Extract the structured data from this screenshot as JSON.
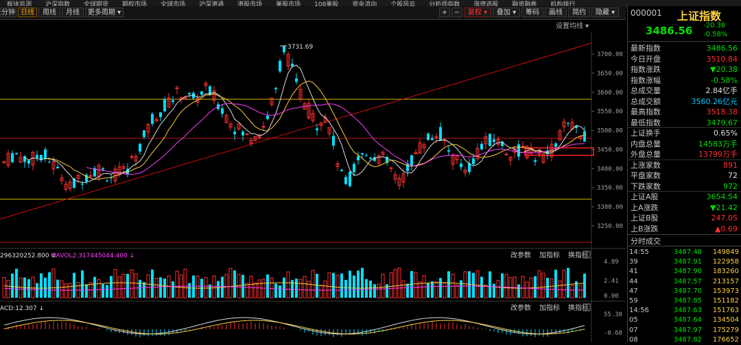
{
  "top_nav": [
    "板块监测",
    "沪深指数",
    "全球期货",
    "期权市场",
    "全球市场",
    "沪深港通",
    "港股市场",
    "美股市场",
    "108美股",
    "资金流向",
    "个股风云",
    "分析师指数",
    "涨停选股",
    "融资融券",
    "机构排行"
  ],
  "toolbar": {
    "periods": [
      {
        "label": "分钟",
        "active": false
      },
      {
        "label": "日线",
        "active": true
      },
      {
        "label": "周线",
        "active": false
      },
      {
        "label": "月线",
        "active": false
      },
      {
        "label": "更多周期 ▾",
        "active": false
      }
    ],
    "right_buttons": [
      {
        "label": "+",
        "kind": "plain"
      },
      {
        "label": "−",
        "kind": "plain"
      },
      {
        "label": "复权 ▾",
        "kind": "red"
      },
      {
        "label": "叠加 ▾",
        "kind": "plain"
      },
      {
        "label": "筹码",
        "kind": "plain"
      },
      {
        "label": "画线",
        "kind": "plain"
      },
      {
        "label": "简约",
        "kind": "plain"
      },
      {
        "label": "隐藏 ▾",
        "kind": "plain"
      }
    ],
    "settings_ma": "设置均线 ▾"
  },
  "main_chart": {
    "high_marker": "3731.69",
    "y_ticks": [
      "3700.00",
      "3650.00",
      "3600.00",
      "3550.00",
      "3500.00",
      "3450.00",
      "3400.00",
      "3350.00",
      "3300.00",
      "3250.00"
    ]
  },
  "volume_panel": {
    "label1": "296320252.800 ↓",
    "label2": "MAVOL2:317445044.400 ↓",
    "buttons": [
      "改参数",
      "加指标",
      "换指标"
    ],
    "y_ticks": [
      "4.89",
      "2.41",
      "0.00"
    ]
  },
  "macd_panel": {
    "label": "ACD:12.307 ↓",
    "buttons": [
      "改参数",
      "加指标",
      "换指标"
    ],
    "y_ticks": [
      "55.30",
      "-0.68"
    ]
  },
  "quote": {
    "code": "000001",
    "name": "上证指数",
    "price": "3486.56",
    "change": "-20.38",
    "change_pct": "-0.58%",
    "rows": [
      {
        "label": "最新指数",
        "value": "3486.56",
        "color": "#00e000"
      },
      {
        "label": "今日开盘",
        "value": "3510.84",
        "color": "#ff3030"
      },
      {
        "label": "指数涨跌",
        "value": "▼20.38",
        "color": "#00e000"
      },
      {
        "label": "指数涨幅",
        "value": "-0.58%",
        "color": "#00e000"
      },
      {
        "label": "总成交量",
        "value": "2.84亿手",
        "color": "#e0e0e0"
      },
      {
        "label": "总成交额",
        "value": "3560.26亿元",
        "color": "#00c8ff"
      },
      {
        "label": "最高指数",
        "value": "3518.38",
        "color": "#ff3030"
      },
      {
        "label": "最低指数",
        "value": "3479.67",
        "color": "#00e000"
      },
      {
        "label": "上证换手",
        "value": "0.65%",
        "color": "#e0e0e0"
      },
      {
        "label": "内盘总量",
        "value": "14583万手",
        "color": "#00e000"
      },
      {
        "label": "外盘总量",
        "value": "13799万手",
        "color": "#ff3030"
      },
      {
        "label": "上涨家数",
        "value": "891",
        "color": "#ff3030"
      },
      {
        "label": "平盘家数",
        "value": "72",
        "color": "#e0e0e0"
      },
      {
        "label": "下跌家数",
        "value": "972",
        "color": "#00e000"
      },
      {
        "label": "上证A股",
        "value": "3654.54",
        "color": "#00e000"
      },
      {
        "label": "上A涨跌",
        "value": "▼21.42",
        "color": "#00e000"
      },
      {
        "label": "上证B股",
        "value": "247.05",
        "color": "#ff3030"
      },
      {
        "label": "上B涨跌",
        "value": "▲0.69",
        "color": "#ff3030"
      }
    ],
    "ticks_title": "分时成交",
    "ticks": [
      {
        "time": "14:55",
        "price": "3487.48",
        "vol": "149849"
      },
      {
        "time": "39",
        "price": "3487.91",
        "vol": "122958"
      },
      {
        "time": "41",
        "price": "3487.90",
        "vol": "183260"
      },
      {
        "time": "44",
        "price": "3487.57",
        "vol": "213157"
      },
      {
        "time": "47",
        "price": "3487.70",
        "vol": "153973"
      },
      {
        "time": "59",
        "price": "3487.85",
        "vol": "151182"
      },
      {
        "time": "14:56",
        "price": "3487.63",
        "vol": "151763"
      },
      {
        "time": "05",
        "price": "3487.64",
        "vol": "134504"
      },
      {
        "time": "07",
        "price": "3487.97",
        "vol": "175279"
      },
      {
        "time": "08",
        "price": "3487.82",
        "vol": "176652"
      }
    ]
  },
  "colors": {
    "up": "#ff3030",
    "down": "#00e0ff",
    "level": "#d8c000",
    "trend": "#d01010"
  }
}
